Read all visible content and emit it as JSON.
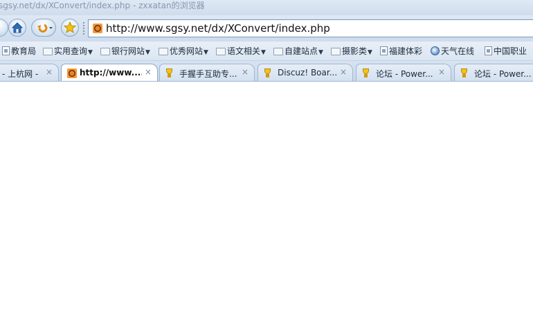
{
  "window": {
    "title": "sgsy.net/dx/XConvert/index.php - zxxatan的浏览器"
  },
  "toolbar": {
    "address": "http://www.sgsy.net/dx/XConvert/index.php"
  },
  "bookmarks": [
    {
      "label": "教育局",
      "type": "page"
    },
    {
      "label": "实用查询",
      "type": "folder",
      "dropdown": true
    },
    {
      "label": "银行网站",
      "type": "folder",
      "dropdown": true
    },
    {
      "label": "优秀网站",
      "type": "folder",
      "dropdown": true
    },
    {
      "label": "语文相关",
      "type": "folder",
      "dropdown": true
    },
    {
      "label": "自建站点",
      "type": "folder",
      "dropdown": true
    },
    {
      "label": "摄影类",
      "type": "folder",
      "dropdown": true
    },
    {
      "label": "福建体彩",
      "type": "page"
    },
    {
      "label": "天气在线",
      "type": "globe"
    },
    {
      "label": "中国职业",
      "type": "page"
    }
  ],
  "tabs": [
    {
      "label": "- 上杭网 -",
      "close": "×",
      "icon": "none",
      "active": false
    },
    {
      "label": "http://www....",
      "close": "×",
      "icon": "site-icon",
      "active": true
    },
    {
      "label": "手握手互助专...",
      "close": "×",
      "icon": "trophy-icon",
      "active": false
    },
    {
      "label": "Discuz! Boar...",
      "close": "×",
      "icon": "trophy-icon",
      "active": false
    },
    {
      "label": "论坛 - Power...",
      "close": "×",
      "icon": "trophy-icon",
      "active": false
    },
    {
      "label": "论坛 - Power...",
      "close": "×",
      "icon": "trophy-icon",
      "active": false
    }
  ],
  "colors": {
    "chrome": "#d7e3f1",
    "accent": "#2f6db6",
    "content": "#ffffff"
  }
}
